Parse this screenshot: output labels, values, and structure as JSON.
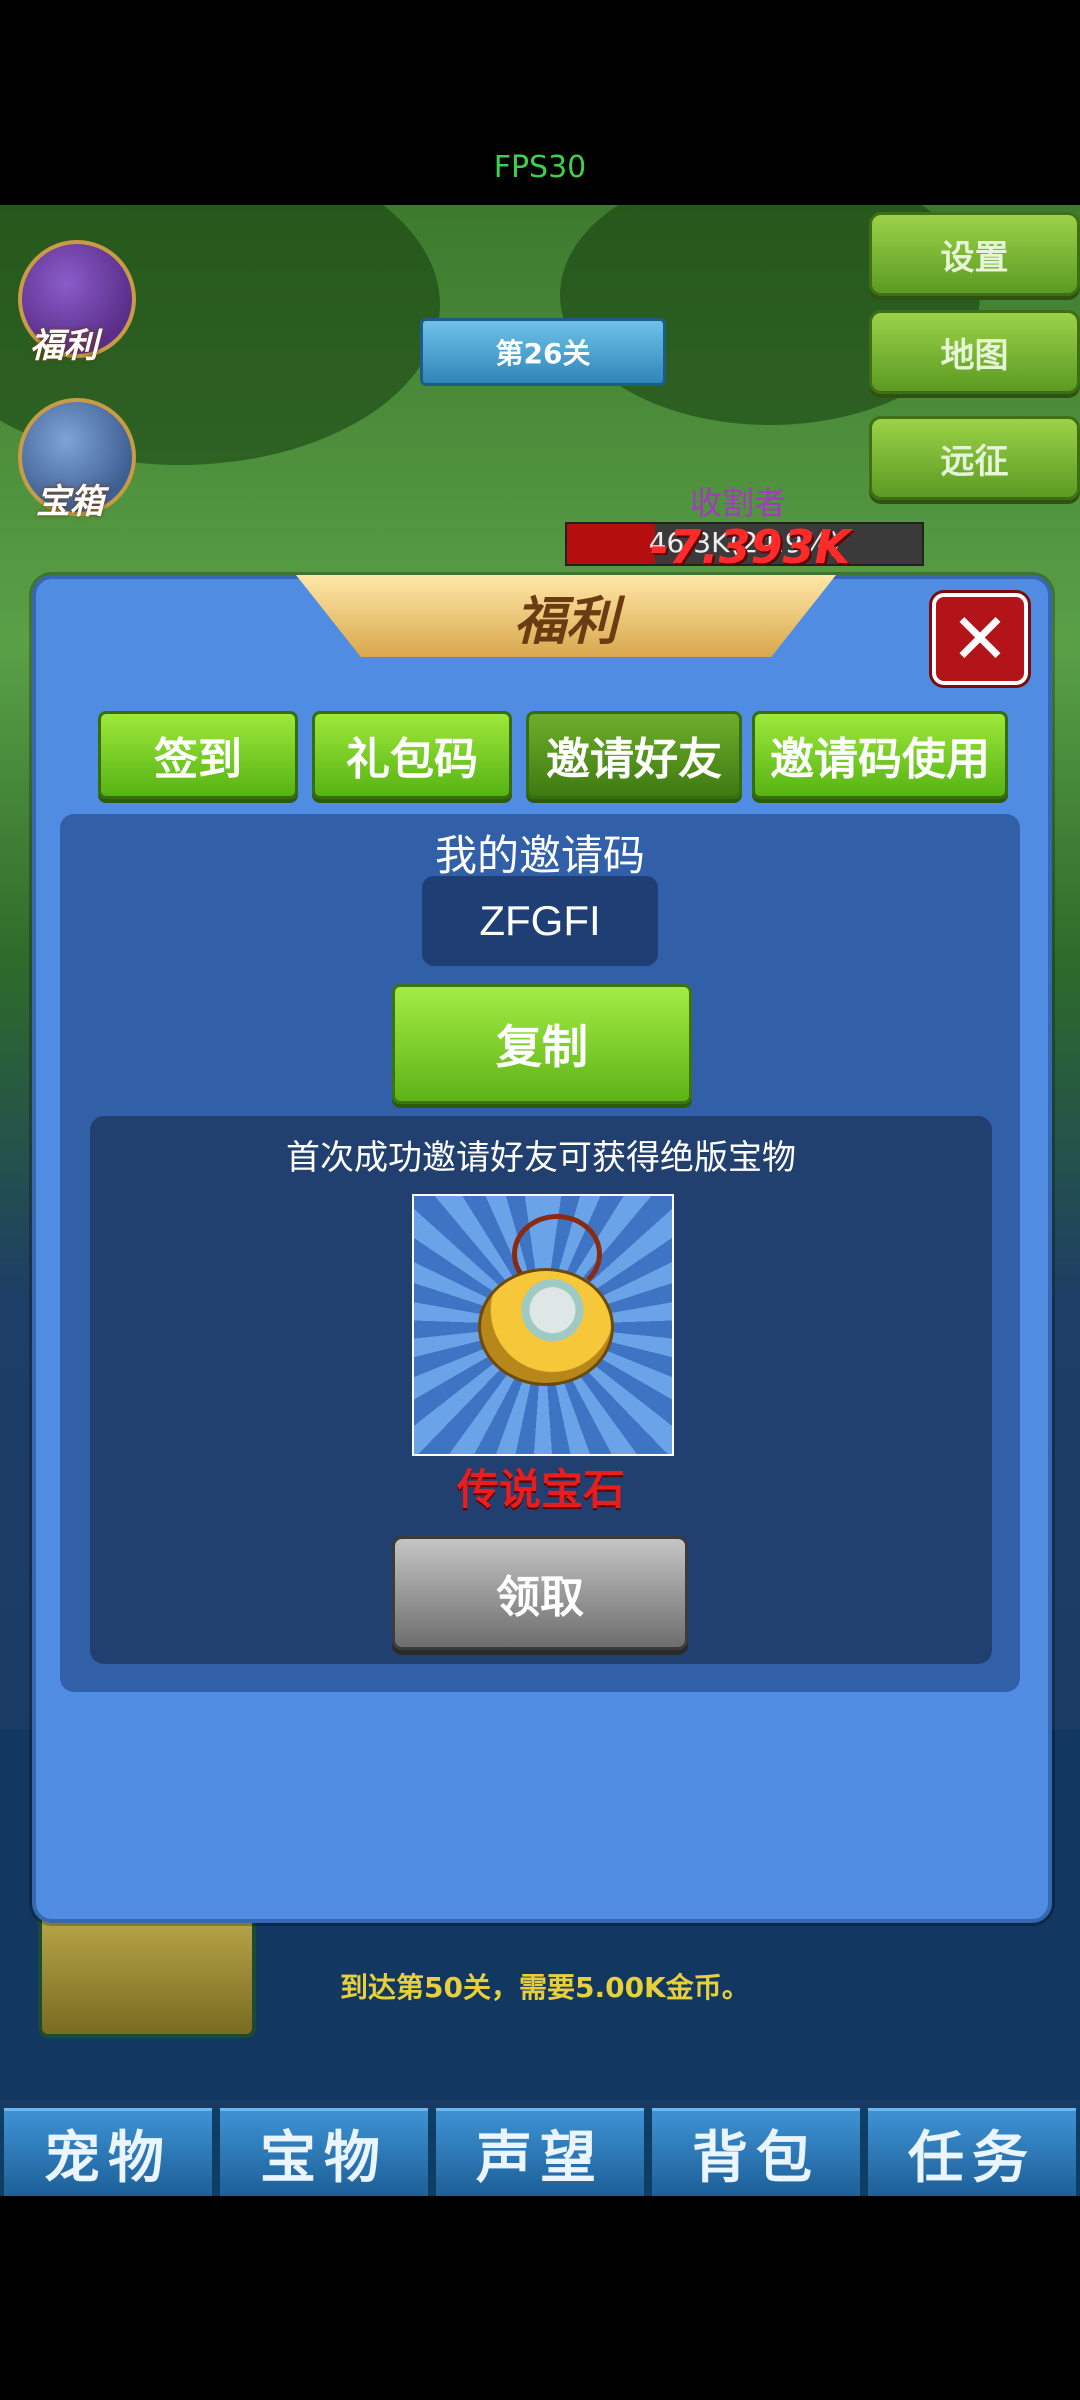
{
  "status": {
    "fps": "FPS30"
  },
  "game": {
    "level": "第26关",
    "side_menu": [
      "福利",
      "宝箱"
    ],
    "top_buttons": [
      "设置",
      "地图",
      "远征"
    ],
    "enemy": {
      "name": "收割者",
      "hp_text": "46.3K(24.9%)",
      "hp_percent": 24.9,
      "damage_text": "-7.393K"
    },
    "bottom_hint": "到达第50关，需要5.00K金币。",
    "bottom_nav": [
      "宠物",
      "宝物",
      "声望",
      "背包",
      "任务"
    ]
  },
  "modal": {
    "title": "福利",
    "tabs": [
      "签到",
      "礼包码",
      "邀请好友",
      "邀请码使用"
    ],
    "active_tab": "邀请好友",
    "invite_code_title": "我的邀请码",
    "invite_code": "ZFGFI",
    "copy_label": "复制",
    "reward_description": "首次成功邀请好友可获得绝版宝物",
    "reward_name": "传说宝石",
    "claim_label": "领取"
  },
  "colors": {
    "modal_bg": "#4f8ce2",
    "green_button": "#7fcf28",
    "reward_name": "#e81e1e",
    "fps_text": "#3fd04a"
  },
  "icons": [
    "close-icon",
    "welfare-icon",
    "treasure-chest-icon",
    "legendary-gem-icon"
  ]
}
